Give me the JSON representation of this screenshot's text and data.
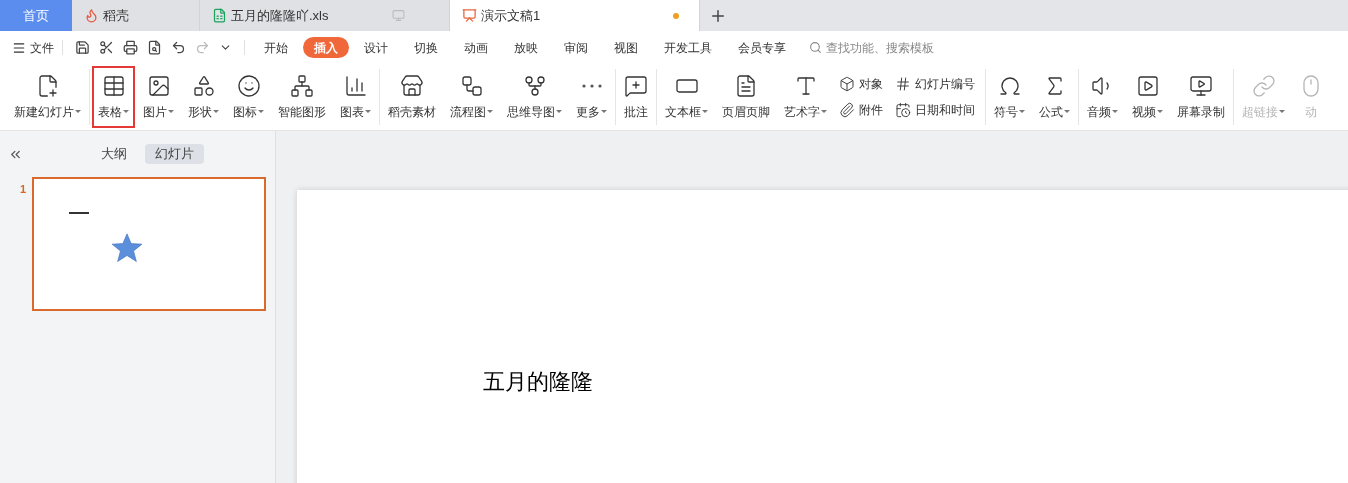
{
  "tabs": [
    {
      "label": "首页",
      "kind": "home",
      "selected": false,
      "unsaved": false
    },
    {
      "label": "稻壳",
      "kind": "store",
      "selected": false,
      "unsaved": false
    },
    {
      "label": "五月的隆隆吖.xls",
      "kind": "sheet",
      "selected": false,
      "unsaved": false
    },
    {
      "label": "演示文稿1",
      "kind": "slides",
      "selected": true,
      "unsaved": true
    }
  ],
  "menu": {
    "file": "文件",
    "tabs": [
      {
        "label": "开始",
        "selected": false
      },
      {
        "label": "插入",
        "selected": true
      },
      {
        "label": "设计",
        "selected": false
      },
      {
        "label": "切换",
        "selected": false
      },
      {
        "label": "动画",
        "selected": false
      },
      {
        "label": "放映",
        "selected": false
      },
      {
        "label": "审阅",
        "selected": false
      },
      {
        "label": "视图",
        "selected": false
      },
      {
        "label": "开发工具",
        "selected": false
      },
      {
        "label": "会员专享",
        "selected": false
      }
    ],
    "search": {
      "placeholder": "查找功能、搜索模板"
    }
  },
  "ribbon": [
    [
      {
        "kind": "large",
        "label": "新建幻灯片",
        "dropdown": true,
        "highlighted": false,
        "disabled": false
      }
    ],
    [
      {
        "kind": "large",
        "label": "表格",
        "dropdown": true,
        "highlighted": true,
        "disabled": false
      },
      {
        "kind": "large",
        "label": "图片",
        "dropdown": true,
        "highlighted": false,
        "disabled": false
      },
      {
        "kind": "large",
        "label": "形状",
        "dropdown": true,
        "highlighted": false,
        "disabled": false
      },
      {
        "kind": "large",
        "label": "图标",
        "dropdown": true,
        "highlighted": false,
        "disabled": false
      },
      {
        "kind": "large",
        "label": "智能图形",
        "dropdown": false,
        "highlighted": false,
        "disabled": false
      },
      {
        "kind": "large",
        "label": "图表",
        "dropdown": true,
        "highlighted": false,
        "disabled": false
      }
    ],
    [
      {
        "kind": "large",
        "label": "稻壳素材",
        "dropdown": false,
        "highlighted": false,
        "disabled": false
      },
      {
        "kind": "large",
        "label": "流程图",
        "dropdown": true,
        "highlighted": false,
        "disabled": false
      },
      {
        "kind": "large",
        "label": "思维导图",
        "dropdown": true,
        "highlighted": false,
        "disabled": false
      },
      {
        "kind": "large",
        "label": "更多",
        "dropdown": true,
        "highlighted": false,
        "disabled": false
      }
    ],
    [
      {
        "kind": "large",
        "label": "批注",
        "dropdown": false,
        "highlighted": false,
        "disabled": false
      }
    ],
    [
      {
        "kind": "large",
        "label": "文本框",
        "dropdown": true,
        "highlighted": false,
        "disabled": false
      },
      {
        "kind": "large",
        "label": "页眉页脚",
        "dropdown": false,
        "highlighted": false,
        "disabled": false
      },
      {
        "kind": "large",
        "label": "艺术字",
        "dropdown": true,
        "highlighted": false,
        "disabled": false
      },
      {
        "kind": "small",
        "label": "对象",
        "dropdown": false,
        "highlighted": false,
        "disabled": false
      },
      {
        "kind": "small",
        "label": "附件",
        "dropdown": false,
        "highlighted": false,
        "disabled": false
      },
      {
        "kind": "small",
        "label": "幻灯片编号",
        "dropdown": false,
        "highlighted": false,
        "disabled": false
      },
      {
        "kind": "small",
        "label": "日期和时间",
        "dropdown": false,
        "highlighted": false,
        "disabled": false
      }
    ],
    [
      {
        "kind": "large",
        "label": "符号",
        "dropdown": true,
        "highlighted": false,
        "disabled": false
      },
      {
        "kind": "large",
        "label": "公式",
        "dropdown": true,
        "highlighted": false,
        "disabled": false
      }
    ],
    [
      {
        "kind": "large",
        "label": "音频",
        "dropdown": true,
        "highlighted": false,
        "disabled": false
      },
      {
        "kind": "large",
        "label": "视频",
        "dropdown": true,
        "highlighted": false,
        "disabled": false
      },
      {
        "kind": "large",
        "label": "屏幕录制",
        "dropdown": false,
        "highlighted": false,
        "disabled": false
      }
    ],
    [
      {
        "kind": "large",
        "label": "超链接",
        "dropdown": true,
        "highlighted": false,
        "disabled": true
      },
      {
        "kind": "large",
        "label": "动",
        "dropdown": false,
        "highlighted": false,
        "disabled": true
      }
    ]
  ],
  "sidebar": {
    "views": [
      {
        "label": "大纲",
        "selected": false
      },
      {
        "label": "幻灯片",
        "selected": true
      }
    ],
    "slides": [
      {
        "number": "1",
        "selected": true
      }
    ]
  },
  "slide": {
    "text": "五月的隆隆"
  }
}
